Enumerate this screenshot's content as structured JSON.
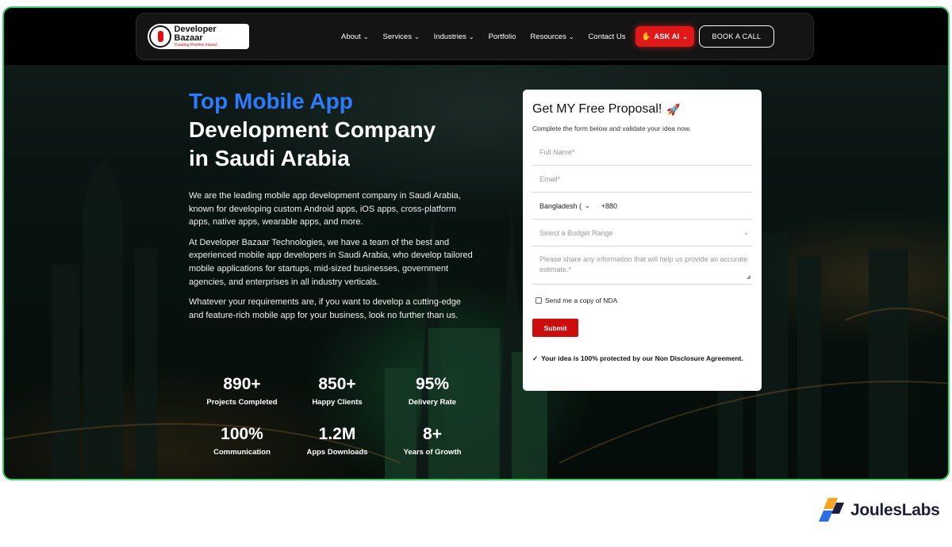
{
  "nav": {
    "logo_name": "Developer Bazaar",
    "logo_tagline": "Creating Positive Impact",
    "links": [
      {
        "label": "About",
        "dropdown": true
      },
      {
        "label": "Services",
        "dropdown": true
      },
      {
        "label": "Industries",
        "dropdown": true
      },
      {
        "label": "Portfolio",
        "dropdown": false
      },
      {
        "label": "Resources",
        "dropdown": true
      },
      {
        "label": "Contact Us",
        "dropdown": false
      }
    ],
    "ask_ai": "ASK AI",
    "book_call": "BOOK A CALL"
  },
  "hero": {
    "title_highlight": "Top Mobile App",
    "title_line2": "Development Company",
    "title_line3": "in Saudi Arabia",
    "paragraphs": [
      "We are the leading mobile app development company in Saudi Arabia, known for developing custom Android apps, iOS apps, cross-platform apps, native apps, wearable apps, and more.",
      "At Developer Bazaar Technologies, we have a team of the best and experienced mobile app developers in Saudi Arabia, who develop tailored mobile applications for startups, mid-sized businesses, government agencies, and enterprises in all industry verticals.",
      "Whatever your requirements are, if you want to develop a cutting-edge and feature-rich mobile app for your business, look no further than us."
    ],
    "stats": [
      {
        "value": "890+",
        "label": "Projects Completed"
      },
      {
        "value": "850+",
        "label": "Happy Clients"
      },
      {
        "value": "95%",
        "label": "Delivery Rate"
      },
      {
        "value": "100%",
        "label": "Communication"
      },
      {
        "value": "1.2M",
        "label": "Apps Downloads"
      },
      {
        "value": "8+",
        "label": "Years of Growth"
      }
    ]
  },
  "form": {
    "title": "Get MY Free Proposal!",
    "subtitle": "Complete the form below and validate your idea now.",
    "name_placeholder": "Full Name*",
    "email_placeholder": "Email*",
    "country": "Bangladesh (",
    "dial_code": "+880",
    "budget_placeholder": "Select a Budget Range",
    "message_placeholder": "Please share any information that will help us provide an accurate estimate.*",
    "nda_label": "Send me a copy of NDA",
    "submit": "Submit",
    "protection_note": "Your idea is 100% protected by our Non Disclosure Agreement."
  },
  "footer": {
    "brand": "JoulesLabs"
  },
  "colors": {
    "accent_blue": "#2d7bff",
    "ask_ai_red": "#e01818",
    "submit_red": "#cc0d0d",
    "frame_green": "#3ccf6b"
  }
}
